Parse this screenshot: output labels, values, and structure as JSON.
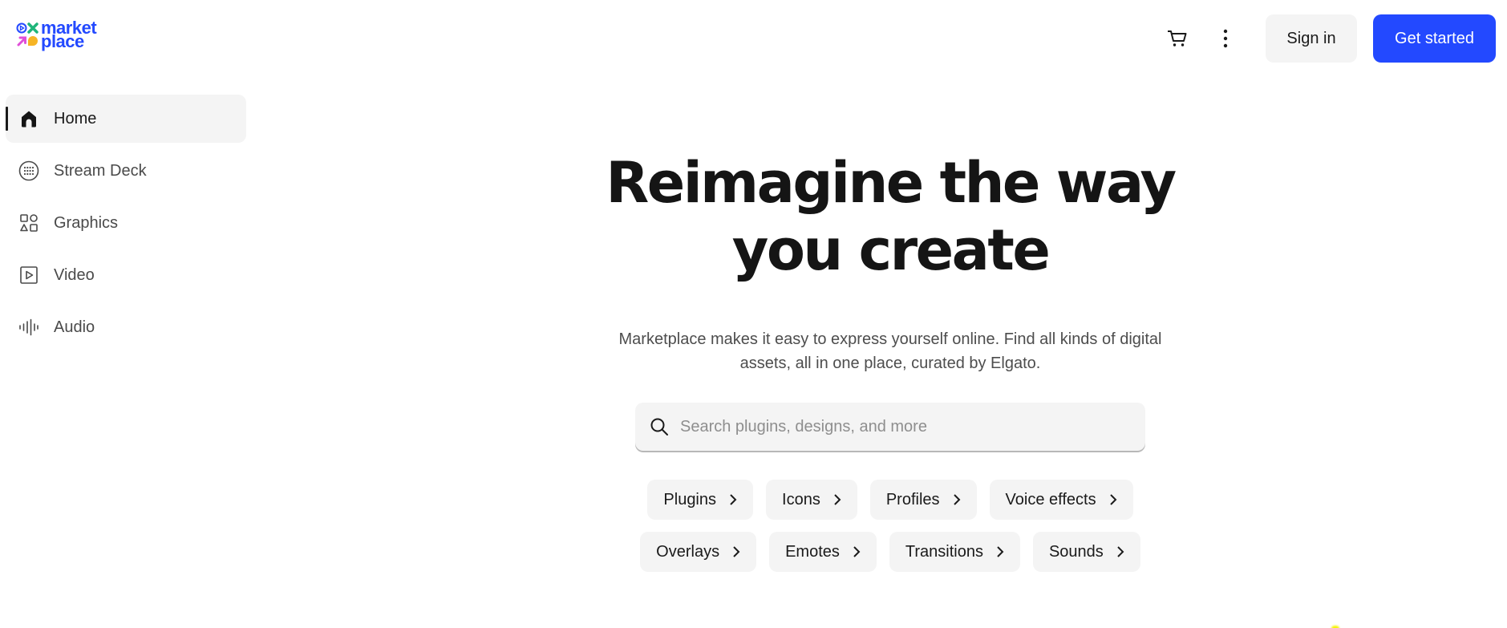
{
  "brand": {
    "name_line1": "market",
    "name_line2": "place",
    "accent_color": "#2349ff"
  },
  "header": {
    "cart_icon": "cart-icon",
    "more_icon": "more-vertical-icon",
    "signin_label": "Sign in",
    "get_started_label": "Get started"
  },
  "sidebar": {
    "items": [
      {
        "label": "Home",
        "icon": "home-icon",
        "active": true
      },
      {
        "label": "Stream Deck",
        "icon": "stream-deck-icon",
        "active": false
      },
      {
        "label": "Graphics",
        "icon": "shapes-icon",
        "active": false
      },
      {
        "label": "Video",
        "icon": "play-icon",
        "active": false
      },
      {
        "label": "Audio",
        "icon": "waveform-icon",
        "active": false
      }
    ]
  },
  "hero": {
    "title_line1": "Reimagine the way",
    "title_line2_prefix": "you",
    "title_line2_highlight": "create",
    "subtitle": "Marketplace makes it easy to express yourself online. Find all kinds of digital assets, all in one place, curated by Elgato."
  },
  "search": {
    "value": "",
    "placeholder": "Search plugins, designs, and more"
  },
  "categories": {
    "row1": [
      "Plugins",
      "Icons",
      "Profiles",
      "Voice effects"
    ],
    "row2": [
      "Overlays",
      "Emotes",
      "Transitions",
      "Sounds"
    ]
  }
}
